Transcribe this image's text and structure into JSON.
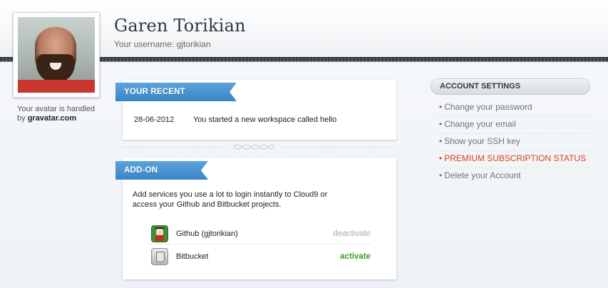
{
  "profile": {
    "name": "Garen Torikian",
    "username_line": "Your username: gjtorikian",
    "avatar_note_prefix": "Your avatar is handled by ",
    "avatar_note_link": "gravatar.com"
  },
  "activity": {
    "title": "YOUR RECENT ACTIVITY",
    "items": [
      {
        "date": "28-06-2012",
        "text": "You started a new workspace called hello"
      }
    ]
  },
  "addons": {
    "title": "ADD-ON SERVICES",
    "description": "Add services you use a lot to login instantly to Cloud9 or access your Github and Bitbucket projects.",
    "services": [
      {
        "name": "Github (gjtorikian)",
        "action": "deactivate",
        "icon": "github-octocat-icon"
      },
      {
        "name": "Bitbucket",
        "action": "activate",
        "icon": "bitbucket-icon"
      }
    ]
  },
  "account_settings": {
    "title": "ACCOUNT SETTINGS",
    "items": [
      {
        "label": "Change your password"
      },
      {
        "label": "Change your email"
      },
      {
        "label": "Show your SSH key"
      },
      {
        "label": "PREMIUM SUBSCRIPTION STATUS"
      },
      {
        "label": "Delete your Account"
      }
    ],
    "bullet": "•"
  },
  "colors": {
    "ribbon_blue": "#3a84c4",
    "activate_green": "#36a020",
    "highlight_orange": "#d9421c",
    "muted_action": "#a7abae"
  }
}
